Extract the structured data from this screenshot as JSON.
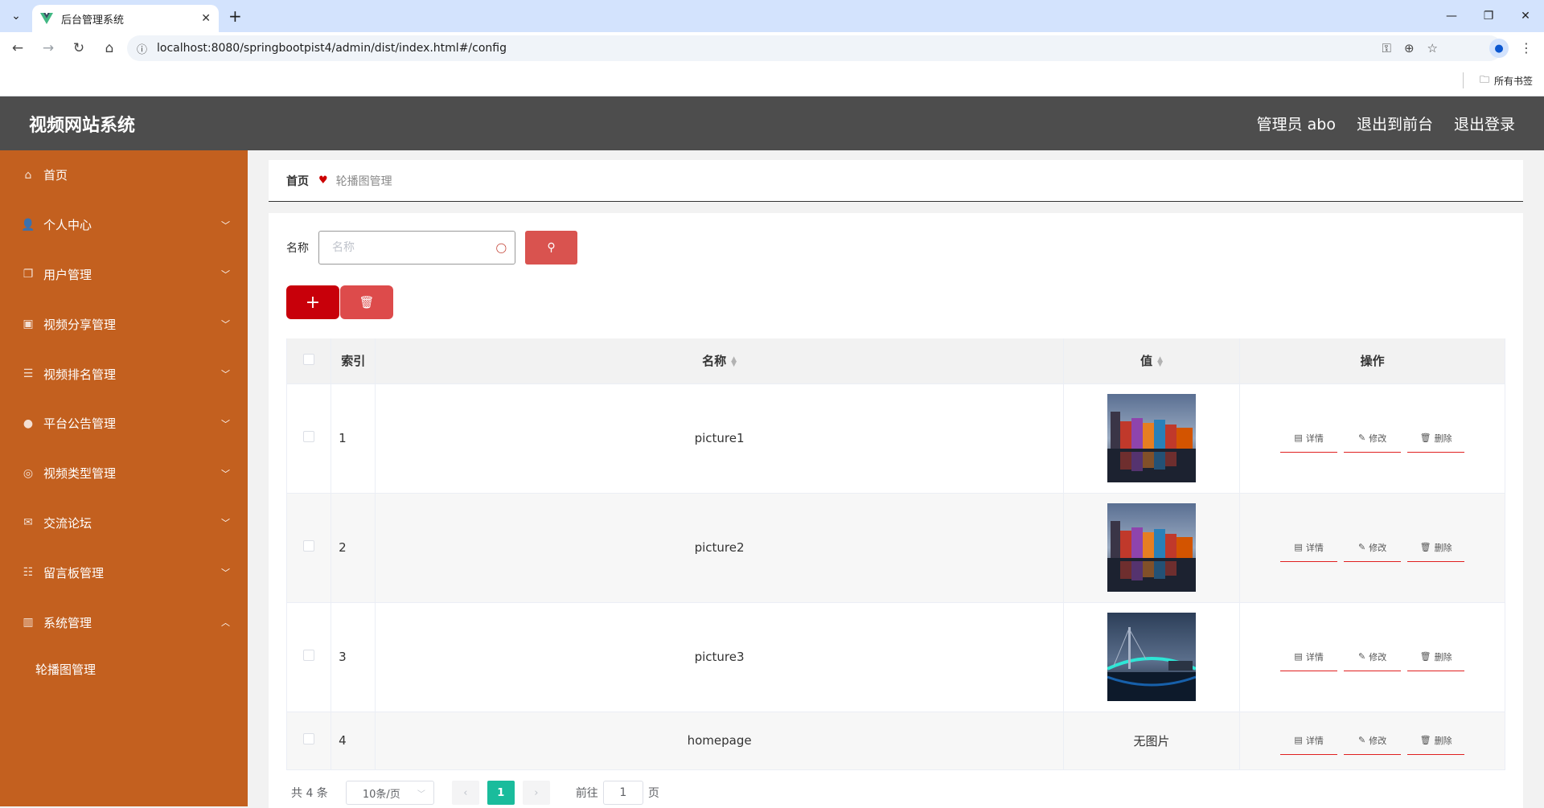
{
  "browser": {
    "tab_title": "后台管理系统",
    "url": "localhost:8080/springbootpist4/admin/dist/index.html#/config",
    "bookmarks_folder": "所有书签"
  },
  "header": {
    "app_title": "视频网站系统",
    "user_label": "管理员 abo",
    "to_front": "退出到前台",
    "logout": "退出登录"
  },
  "sidebar": {
    "items": [
      {
        "label": "首页",
        "icon": "home-icon"
      },
      {
        "label": "个人中心",
        "icon": "user-icon"
      },
      {
        "label": "用户管理",
        "icon": "copy-icon"
      },
      {
        "label": "视频分享管理",
        "icon": "clipboard-icon"
      },
      {
        "label": "视频排名管理",
        "icon": "list-icon"
      },
      {
        "label": "平台公告管理",
        "icon": "location-icon"
      },
      {
        "label": "视频类型管理",
        "icon": "globe-icon"
      },
      {
        "label": "交流论坛",
        "icon": "mail-icon"
      },
      {
        "label": "留言板管理",
        "icon": "sliders-icon"
      },
      {
        "label": "系统管理",
        "icon": "books-icon"
      }
    ],
    "sub_item": "轮播图管理"
  },
  "breadcrumb": {
    "home": "首页",
    "current": "轮播图管理"
  },
  "search": {
    "label": "名称",
    "placeholder": "名称"
  },
  "table": {
    "headers": {
      "index": "索引",
      "name": "名称",
      "value": "值",
      "ops": "操作"
    },
    "ops": {
      "detail": "详情",
      "edit": "修改",
      "delete": "删除"
    },
    "rows": [
      {
        "index": "1",
        "name": "picture1",
        "value": "",
        "has_image": true
      },
      {
        "index": "2",
        "name": "picture2",
        "value": "",
        "has_image": true
      },
      {
        "index": "3",
        "name": "picture3",
        "value": "",
        "has_image": true
      },
      {
        "index": "4",
        "name": "homepage",
        "value": "无图片",
        "has_image": false
      }
    ]
  },
  "pagination": {
    "total": "共 4 条",
    "page_size": "10条/页",
    "current_page": "1",
    "goto_label": "前往",
    "goto_value": "1",
    "page_unit": "页"
  },
  "colors": {
    "sidebar": "#c3601f",
    "header": "#4d4d4d",
    "add_button": "#c8000a",
    "delete_button": "#dd4b4b",
    "active_page": "#1abc9c"
  }
}
